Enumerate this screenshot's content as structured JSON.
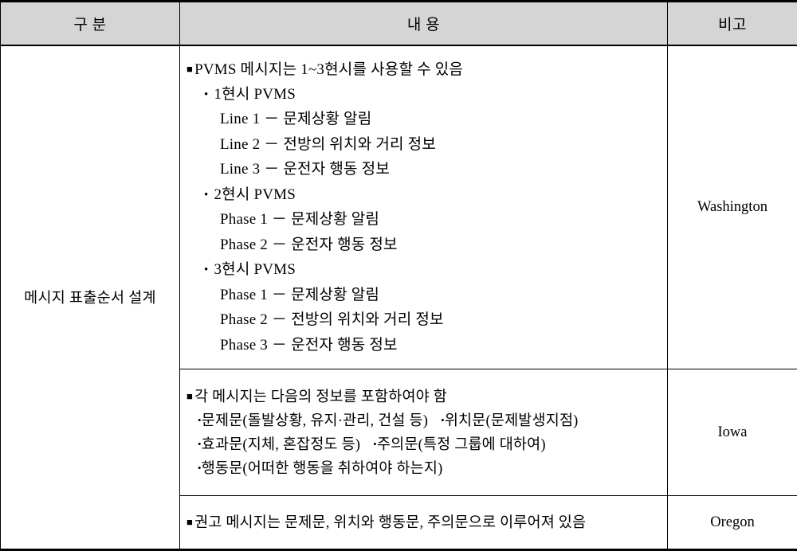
{
  "table": {
    "headers": {
      "col1": "구 분",
      "col2": "내 용",
      "col3": "비고"
    },
    "row_label": "메시지 표출순서 설계",
    "sections": [
      {
        "note": "Washington",
        "lines": [
          {
            "bullet": "square",
            "level": 0,
            "text": "PVMS 메시지는 1~3현시를 사용할 수 있음"
          },
          {
            "bullet": "dot",
            "level": 1,
            "text": "1현시 PVMS"
          },
          {
            "bullet": "none",
            "level": 2,
            "text": "Line 1 － 문제상황 알림"
          },
          {
            "bullet": "none",
            "level": 2,
            "text": "Line 2 － 전방의 위치와 거리 정보"
          },
          {
            "bullet": "none",
            "level": 2,
            "text": "Line 3 － 운전자 행동 정보"
          },
          {
            "bullet": "dot",
            "level": 1,
            "text": "2현시 PVMS"
          },
          {
            "bullet": "none",
            "level": 2,
            "text": "Phase 1 － 문제상황 알림"
          },
          {
            "bullet": "none",
            "level": 2,
            "text": "Phase 2 － 운전자 행동 정보"
          },
          {
            "bullet": "dot",
            "level": 1,
            "text": "3현시 PVMS"
          },
          {
            "bullet": "none",
            "level": 2,
            "text": "Phase 1 － 문제상황 알림"
          },
          {
            "bullet": "none",
            "level": 2,
            "text": "Phase 2 － 전방의 위치와 거리 정보"
          },
          {
            "bullet": "none",
            "level": 2,
            "text": "Phase 3 － 운전자 행동 정보"
          }
        ]
      },
      {
        "note": "Iowa",
        "lines": [
          {
            "bullet": "square",
            "level": 0,
            "text": "각 메시지는 다음의 정보를 포함하여야 함"
          },
          {
            "bullet": "dot-tight",
            "level": 1,
            "text": "문제문(돌발상황, 유지·관리, 건설 등)",
            "text2": "위치문(문제발생지점)"
          },
          {
            "bullet": "dot-tight",
            "level": 1,
            "text": "효과문(지체, 혼잡정도 등)",
            "text2": "주의문(특정 그룹에 대하여)"
          },
          {
            "bullet": "dot-tight",
            "level": 1,
            "text": "행동문(어떠한 행동을 취하여야 하는지)"
          }
        ]
      },
      {
        "note": "Oregon",
        "lines": [
          {
            "bullet": "square",
            "level": 0,
            "text": "권고 메시지는 문제문, 위치와 행동문, 주의문으로 이루어져 있음"
          }
        ]
      }
    ]
  },
  "glyphs": {
    "square_bullet": "■",
    "dot_bullet": "•"
  },
  "colors": {
    "header_bg": "#d5d5d5",
    "border": "#000000",
    "text": "#000000"
  }
}
